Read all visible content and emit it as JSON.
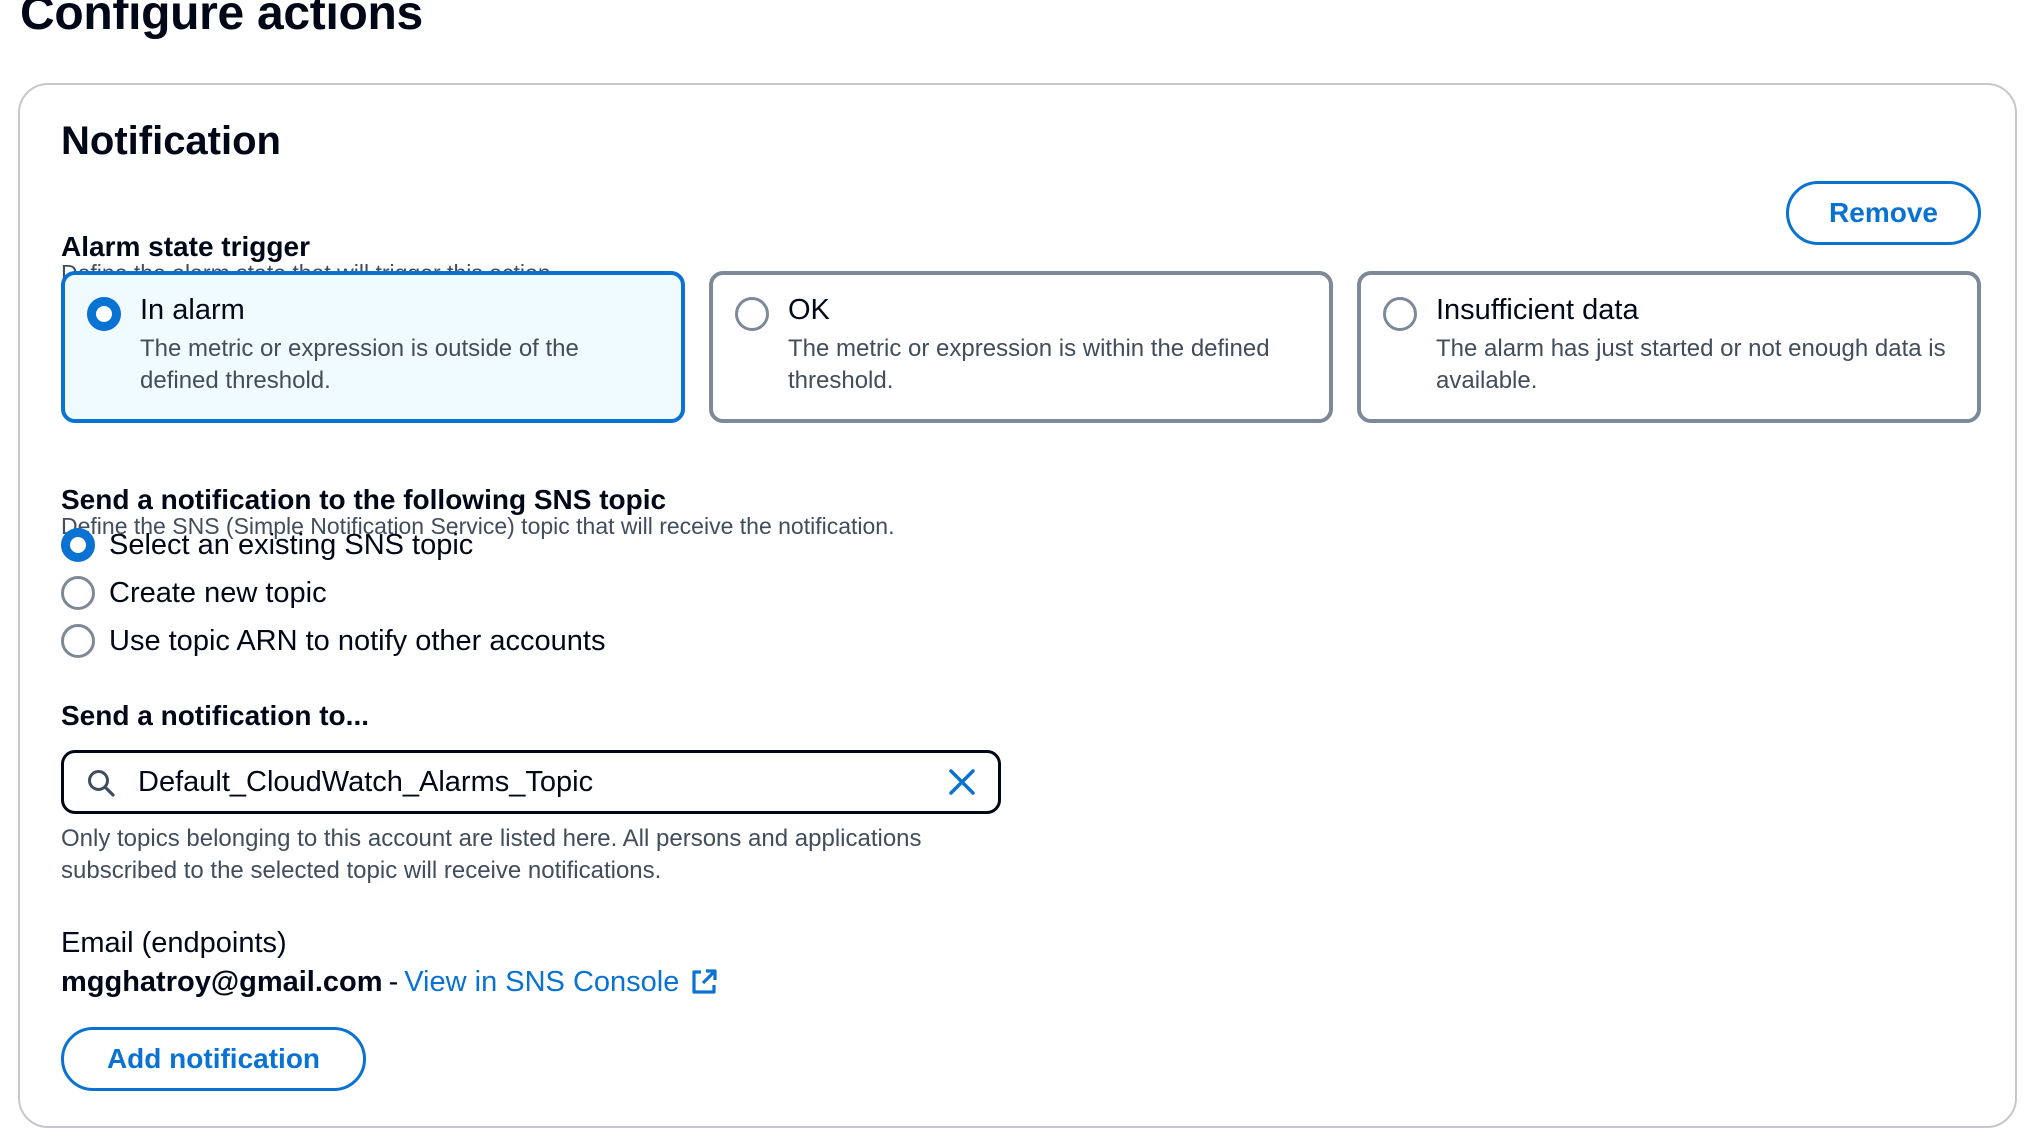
{
  "page": {
    "title": "Configure actions"
  },
  "notification": {
    "title": "Notification",
    "remove_label": "Remove",
    "alarm_state": {
      "label": "Alarm state trigger",
      "description": "Define the alarm state that will trigger this action.",
      "options": [
        {
          "label": "In alarm",
          "description": "The metric or expression is outside of the defined threshold.",
          "selected": true
        },
        {
          "label": "OK",
          "description": "The metric or expression is within the defined threshold.",
          "selected": false
        },
        {
          "label": "Insufficient data",
          "description": "The alarm has just started or not enough data is available.",
          "selected": false
        }
      ]
    },
    "sns_topic": {
      "label": "Send a notification to the following SNS topic",
      "description": "Define the SNS (Simple Notification Service) topic that will receive the notification.",
      "options": [
        {
          "label": "Select an existing SNS topic",
          "selected": true
        },
        {
          "label": "Create new topic",
          "selected": false
        },
        {
          "label": "Use topic ARN to notify other accounts",
          "selected": false
        }
      ]
    },
    "send_to": {
      "label": "Send a notification to...",
      "value": "Default_CloudWatch_Alarms_Topic",
      "hint": "Only topics belonging to this account are listed here. All persons and applications subscribed to the selected topic will receive notifications."
    },
    "endpoints": {
      "label": "Email (endpoints)",
      "email": "mgghatroy@gmail.com",
      "separator": "-",
      "console_link": "View in SNS Console"
    },
    "add_label": "Add notification"
  },
  "colors": {
    "accent": "#0972d3",
    "text": "#000716",
    "muted": "#414d5c",
    "border": "#7d8998",
    "selected_bg": "#f0fbff"
  },
  "icons": {
    "search": "search-icon",
    "clear": "close-icon",
    "external": "external-link-icon"
  }
}
